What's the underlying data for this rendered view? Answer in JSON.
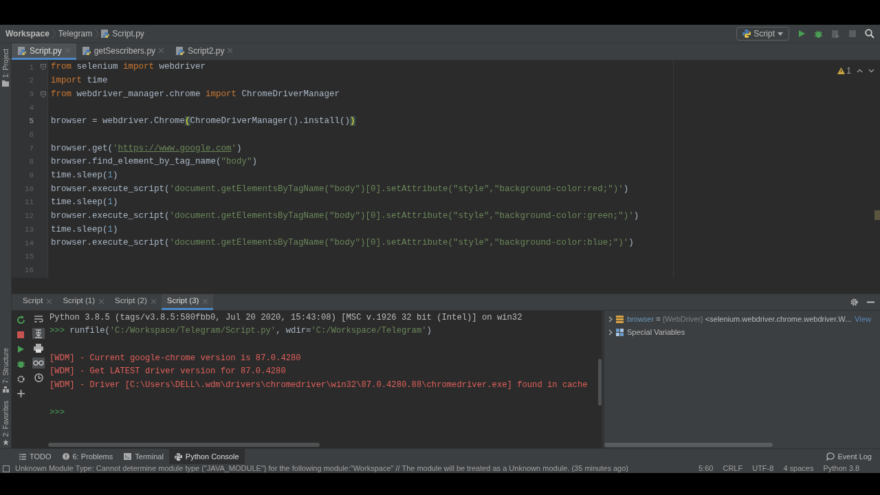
{
  "breadcrumbs": [
    {
      "label": "Workspace",
      "kind": "folder"
    },
    {
      "label": "Telegram",
      "kind": "folder"
    },
    {
      "label": "Script.py",
      "kind": "file"
    }
  ],
  "run_config": {
    "label": "Script"
  },
  "side_tools_top": [
    {
      "label": "1: Project"
    }
  ],
  "side_tools_bottom": [
    {
      "label": "7: Structure"
    },
    {
      "label": "2: Favorites"
    }
  ],
  "editor_tabs": [
    {
      "label": "Script.py",
      "selected": true
    },
    {
      "label": "getSescribers.py",
      "selected": false
    },
    {
      "label": "Script2.py",
      "selected": false
    }
  ],
  "inspection": {
    "count": "1"
  },
  "code_lines": [
    {
      "number": "1",
      "fold": true,
      "tokens": [
        {
          "kind": "kw",
          "text": "from"
        },
        {
          "kind": "plain",
          "text": " selenium "
        },
        {
          "kind": "kw",
          "text": "import"
        },
        {
          "kind": "plain",
          "text": " webdriver"
        }
      ]
    },
    {
      "number": "2",
      "tokens": [
        {
          "kind": "kw",
          "text": "import"
        },
        {
          "kind": "plain",
          "text": " time"
        }
      ]
    },
    {
      "number": "3",
      "fold": true,
      "tokens": [
        {
          "kind": "kw",
          "text": "from"
        },
        {
          "kind": "plain",
          "text": " webdriver_manager.chrome "
        },
        {
          "kind": "kw",
          "text": "import"
        },
        {
          "kind": "plain",
          "text": " ChromeDriverManager"
        }
      ]
    },
    {
      "number": "4"
    },
    {
      "number": "5",
      "current": true,
      "tokens": [
        {
          "kind": "plain",
          "text": "browser = webdriver.Chrome"
        },
        {
          "kind": "match",
          "text": "("
        },
        {
          "kind": "plain",
          "text": "ChromeDriverManager().install()"
        },
        {
          "kind": "match",
          "text": ")"
        }
      ]
    },
    {
      "number": "6"
    },
    {
      "number": "7",
      "tokens": [
        {
          "kind": "plain",
          "text": "browser.get("
        },
        {
          "kind": "str",
          "text": "'"
        },
        {
          "kind": "link",
          "text": "https://www.google.com"
        },
        {
          "kind": "str",
          "text": "'"
        },
        {
          "kind": "plain",
          "text": ")"
        }
      ]
    },
    {
      "number": "8",
      "tokens": [
        {
          "kind": "plain",
          "text": "browser.find_element_by_tag_name("
        },
        {
          "kind": "str",
          "text": "\"body\""
        },
        {
          "kind": "plain",
          "text": ")"
        }
      ]
    },
    {
      "number": "9",
      "tokens": [
        {
          "kind": "plain",
          "text": "time.sleep("
        },
        {
          "kind": "num",
          "text": "1"
        },
        {
          "kind": "plain",
          "text": ")"
        }
      ]
    },
    {
      "number": "10",
      "tokens": [
        {
          "kind": "plain",
          "text": "browser.execute_script("
        },
        {
          "kind": "str",
          "text": "'document.getElementsByTagName(\"body\")[0].setAttribute(\"style\",\"background-color:red;\")'"
        },
        {
          "kind": "plain",
          "text": ")"
        }
      ]
    },
    {
      "number": "11",
      "tokens": [
        {
          "kind": "plain",
          "text": "time.sleep("
        },
        {
          "kind": "num",
          "text": "1"
        },
        {
          "kind": "plain",
          "text": ")"
        }
      ]
    },
    {
      "number": "12",
      "tokens": [
        {
          "kind": "plain",
          "text": "browser.execute_script("
        },
        {
          "kind": "str",
          "text": "'document.getElementsByTagName(\"body\")[0].setAttribute(\"style\",\"background-color:green;\")'"
        },
        {
          "kind": "plain",
          "text": ")"
        }
      ]
    },
    {
      "number": "13",
      "tokens": [
        {
          "kind": "plain",
          "text": "time.sleep("
        },
        {
          "kind": "num",
          "text": "1"
        },
        {
          "kind": "plain",
          "text": ")"
        }
      ]
    },
    {
      "number": "14",
      "tokens": [
        {
          "kind": "plain",
          "text": "browser.execute_script("
        },
        {
          "kind": "str",
          "text": "'document.getElementsByTagName(\"body\")[0].setAttribute(\"style\",\"background-color:blue;\")'"
        },
        {
          "kind": "plain",
          "text": ")"
        }
      ]
    },
    {
      "number": "15"
    },
    {
      "number": "16"
    }
  ],
  "console_tabs": [
    {
      "label": "Script",
      "selected": false
    },
    {
      "label": "Script (1)",
      "selected": false
    },
    {
      "label": "Script (2)",
      "selected": false
    },
    {
      "label": "Script (3)",
      "selected": true
    }
  ],
  "console_lines": [
    {
      "kind": "info",
      "tokens": [
        {
          "kind": "plain",
          "text": "Python 3.8.5 (tags/v3.8.5:580fbb0, Jul 20 2020, 15:43:08) [MSC v.1926 32 bit (Intel)] on win32"
        }
      ]
    },
    {
      "kind": "input",
      "tokens": [
        {
          "kind": "prompt",
          "text": ">>> "
        },
        {
          "kind": "plain",
          "text": "runfile("
        },
        {
          "kind": "str",
          "text": "'C:/Workspace/Telegram/Script.py'"
        },
        {
          "kind": "plain",
          "text": ", wdir="
        },
        {
          "kind": "str",
          "text": "'C:/Workspace/Telegram'"
        },
        {
          "kind": "plain",
          "text": ")"
        }
      ]
    },
    {
      "kind": "blank"
    },
    {
      "kind": "error",
      "tokens": [
        {
          "kind": "plain",
          "text": "[WDM] - Current google-chrome version is 87.0.4280"
        }
      ]
    },
    {
      "kind": "error",
      "tokens": [
        {
          "kind": "plain",
          "text": "[WDM] - Get LATEST driver version for 87.0.4280"
        }
      ]
    },
    {
      "kind": "error",
      "tokens": [
        {
          "kind": "plain",
          "text": "[WDM] - Driver [C:\\Users\\DELL\\.wdm\\drivers\\chromedriver\\win32\\87.0.4280.88\\chromedriver.exe] found in cache"
        }
      ]
    },
    {
      "kind": "blank"
    },
    {
      "kind": "input",
      "tokens": [
        {
          "kind": "prompt",
          "text": ">>>"
        }
      ]
    }
  ],
  "variables": [
    {
      "kind": "object",
      "name": "browser",
      "eq": "=",
      "type": "{WebDriver}",
      "value": "<selenium.webdriver.chrome.webdriver.W...",
      "link": "View"
    },
    {
      "kind": "group",
      "name": "Special Variables"
    }
  ],
  "tool_windows": [
    {
      "label": "TODO",
      "kind": "list",
      "selected": false
    },
    {
      "label": "6: Problems",
      "kind": "problems",
      "selected": false
    },
    {
      "label": "Terminal",
      "kind": "terminal",
      "selected": false
    },
    {
      "label": "Python Console",
      "kind": "python",
      "selected": true
    }
  ],
  "event_log": {
    "label": "Event Log"
  },
  "status": {
    "message": "Unknown Module Type: Cannot determine module type (\"JAVA_MODULE\") for the following module:\"Workspace\" // The module will be treated as a Unknown module. (35 minutes ago)",
    "items": [
      "5:60",
      "CRLF",
      "UTF-8",
      "4 spaces",
      "Python 3.8"
    ]
  }
}
